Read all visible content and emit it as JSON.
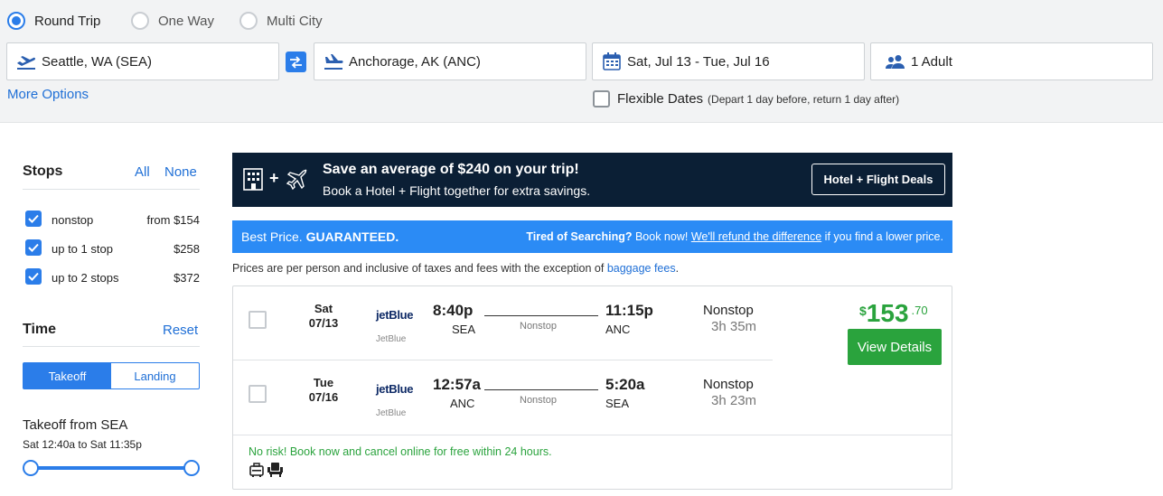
{
  "trip_type": {
    "options": [
      "Round Trip",
      "One Way",
      "Multi City"
    ],
    "selected": "Round Trip"
  },
  "search": {
    "origin": "Seattle, WA (SEA)",
    "destination": "Anchorage, AK (ANC)",
    "dates": "Sat, Jul 13 - Tue, Jul 16",
    "travelers": "1 Adult",
    "more_options": "More Options",
    "flexible_label": "Flexible Dates",
    "flexible_note": "(Depart 1 day before, return 1 day after)"
  },
  "sidebar": {
    "stops_title": "Stops",
    "all": "All",
    "none": "None",
    "stops": [
      {
        "label": "nonstop",
        "price": "from $154",
        "checked": true
      },
      {
        "label": "up to 1 stop",
        "price": "$258",
        "checked": true
      },
      {
        "label": "up to 2 stops",
        "price": "$372",
        "checked": true
      }
    ],
    "time_title": "Time",
    "reset": "Reset",
    "tabs": [
      "Takeoff",
      "Landing"
    ],
    "takeoff_title": "Takeoff from SEA",
    "takeoff_range": "Sat 12:40a to Sat 11:35p"
  },
  "promo": {
    "plus": "+",
    "title": "Save an average of $240 on your trip!",
    "subtitle": "Book a Hotel + Flight together for extra savings.",
    "button": "Hotel + Flight Deals"
  },
  "best_price": {
    "left_prefix": "Best Price. ",
    "left_bold": "GUARANTEED.",
    "tired": "Tired of Searching?",
    "book_now": " Book now! ",
    "refund_link": "We'll refund the difference",
    "suffix": " if you find a lower price."
  },
  "prices_note": {
    "text": "Prices are per person and inclusive of taxes and fees with the exception of ",
    "link": "baggage fees",
    "end": "."
  },
  "result": {
    "legs": [
      {
        "day": "Sat",
        "date": "07/13",
        "airline_logo": "jetBlue",
        "airline": "JetBlue",
        "dep_time": "8:40p",
        "dep_apt": "SEA",
        "mid": "Nonstop",
        "arr_time": "11:15p",
        "arr_apt": "ANC",
        "stops": "Nonstop",
        "duration": "3h 35m"
      },
      {
        "day": "Tue",
        "date": "07/16",
        "airline_logo": "jetBlue",
        "airline": "JetBlue",
        "dep_time": "12:57a",
        "dep_apt": "ANC",
        "mid": "Nonstop",
        "arr_time": "5:20a",
        "arr_apt": "SEA",
        "stops": "Nonstop",
        "duration": "3h 23m"
      }
    ],
    "price_symbol": "$",
    "price_dollars": "153",
    "price_cents": ".70",
    "view_details": "View Details",
    "no_risk": "No risk! Book now and cancel online for free within 24 hours."
  },
  "colors": {
    "accent": "#2b7de9",
    "price_green": "#2aa33d",
    "promo_bg": "#0b1f35",
    "bp_bg": "#2b8bf5"
  }
}
